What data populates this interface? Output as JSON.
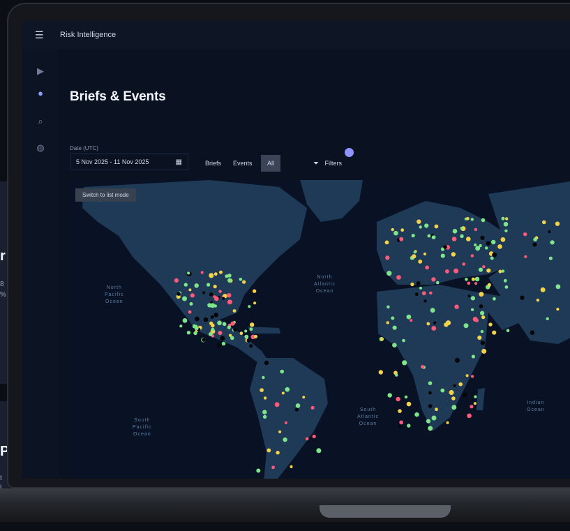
{
  "app": {
    "name": "Risk Intelligence",
    "page_title": "Briefs & Events"
  },
  "peek": {
    "chars": [
      "r",
      "P"
    ],
    "small": [
      "8",
      "%",
      "t",
      "l"
    ]
  },
  "nav": {
    "icons": [
      "play-icon",
      "briefs-icon",
      "search-icon",
      "globe-icon",
      "help-icon"
    ]
  },
  "filters": {
    "date_label": "Date (UTC)",
    "date_value": "5 Nov 2025 - 11 Nov 2025",
    "toggle_briefs": "Briefs",
    "toggle_events": "Events",
    "toggle_all": "All",
    "filters_label": "Filters"
  },
  "map": {
    "hint_button": "Switch to list mode",
    "oceans": {
      "north_pacific": "North\nPacific\nOcean",
      "north_atlantic": "North\nAtlantic\nOcean",
      "south_pacific": "South\nPacific\nOcean",
      "south_atlantic": "South\nAtlantic\nOcean",
      "indian": "Indian\nOcean"
    },
    "event_colors": {
      "green": "#7fe58a",
      "yellow": "#f3d24a",
      "red": "#ff5a7a",
      "black": "#05070b"
    }
  },
  "colors": {
    "land": "#1f3a57",
    "ocean": "#091225",
    "accent": "#8d93ff"
  }
}
